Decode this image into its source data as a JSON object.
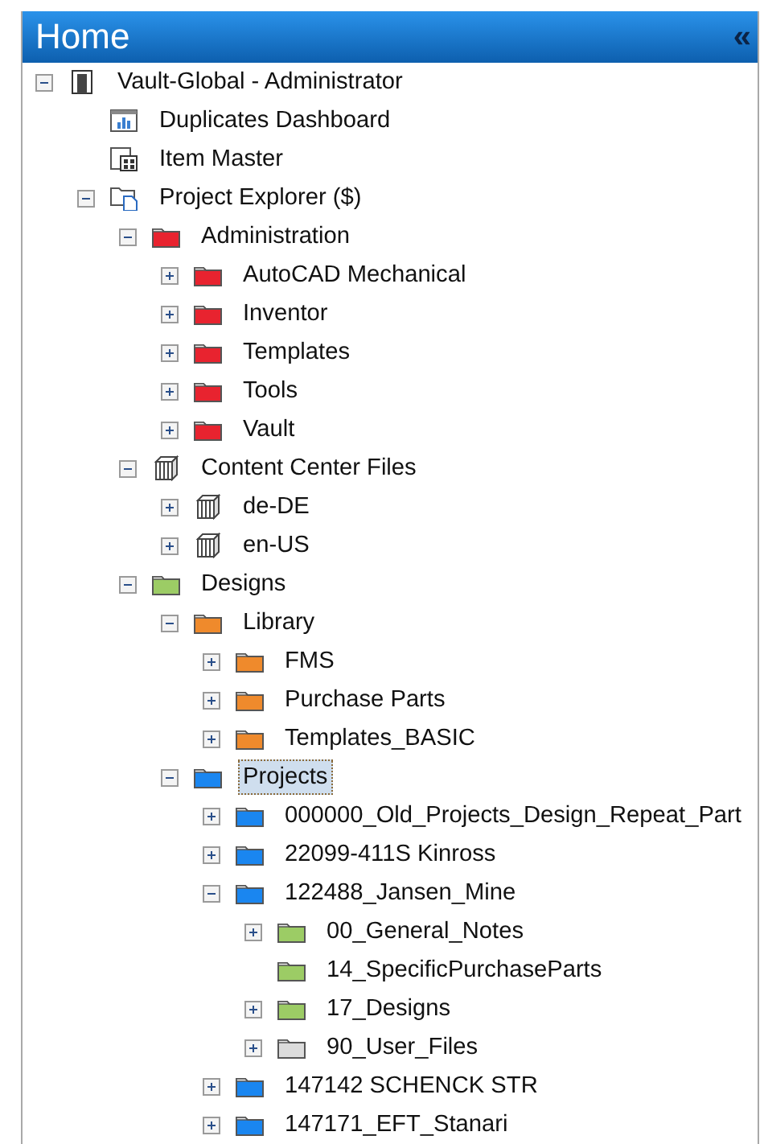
{
  "header": {
    "title": "Home",
    "collapse_glyph": "«"
  },
  "tree": [
    {
      "label": "Vault-Global - Administrator",
      "kind": "vault",
      "expandable": true,
      "expanded": true,
      "selected": false,
      "children": [
        {
          "label": "Duplicates Dashboard",
          "kind": "dashboard",
          "expandable": false,
          "selected": false
        },
        {
          "label": "Item Master",
          "kind": "itemmaster",
          "expandable": false,
          "selected": false
        },
        {
          "label": "Project Explorer ($)",
          "kind": "explorer",
          "expandable": true,
          "expanded": true,
          "selected": false,
          "children": [
            {
              "label": "Administration",
              "kind": "folder",
              "color": "#e8232f",
              "expandable": true,
              "expanded": true,
              "selected": false,
              "children": [
                {
                  "label": "AutoCAD Mechanical",
                  "kind": "folder",
                  "color": "#e8232f",
                  "expandable": true,
                  "expanded": false,
                  "selected": false
                },
                {
                  "label": "Inventor",
                  "kind": "folder",
                  "color": "#e8232f",
                  "expandable": true,
                  "expanded": false,
                  "selected": false
                },
                {
                  "label": "Templates",
                  "kind": "folder",
                  "color": "#e8232f",
                  "expandable": true,
                  "expanded": false,
                  "selected": false
                },
                {
                  "label": "Tools",
                  "kind": "folder",
                  "color": "#e8232f",
                  "expandable": true,
                  "expanded": false,
                  "selected": false
                },
                {
                  "label": "Vault",
                  "kind": "folder",
                  "color": "#e8232f",
                  "expandable": true,
                  "expanded": false,
                  "selected": false
                }
              ]
            },
            {
              "label": "Content Center Files",
              "kind": "library",
              "expandable": true,
              "expanded": true,
              "selected": false,
              "children": [
                {
                  "label": "de-DE",
                  "kind": "library",
                  "expandable": true,
                  "expanded": false,
                  "selected": false
                },
                {
                  "label": "en-US",
                  "kind": "library",
                  "expandable": true,
                  "expanded": false,
                  "selected": false
                }
              ]
            },
            {
              "label": "Designs",
              "kind": "folder",
              "color": "#9ccc65",
              "expandable": true,
              "expanded": true,
              "selected": false,
              "children": [
                {
                  "label": "Library",
                  "kind": "folder",
                  "color": "#ef8a2c",
                  "expandable": true,
                  "expanded": true,
                  "selected": false,
                  "children": [
                    {
                      "label": "FMS",
                      "kind": "folder",
                      "color": "#ef8a2c",
                      "expandable": true,
                      "expanded": false,
                      "selected": false
                    },
                    {
                      "label": "Purchase Parts",
                      "kind": "folder",
                      "color": "#ef8a2c",
                      "expandable": true,
                      "expanded": false,
                      "selected": false
                    },
                    {
                      "label": "Templates_BASIC",
                      "kind": "folder",
                      "color": "#ef8a2c",
                      "expandable": true,
                      "expanded": false,
                      "selected": false
                    }
                  ]
                },
                {
                  "label": "Projects",
                  "kind": "folder",
                  "color": "#1a86f0",
                  "expandable": true,
                  "expanded": true,
                  "selected": true,
                  "children": [
                    {
                      "label": "000000_Old_Projects_Design_Repeat_Part",
                      "kind": "folder",
                      "color": "#1a86f0",
                      "expandable": true,
                      "expanded": false,
                      "selected": false
                    },
                    {
                      "label": "22099-411S Kinross",
                      "kind": "folder",
                      "color": "#1a86f0",
                      "expandable": true,
                      "expanded": false,
                      "selected": false
                    },
                    {
                      "label": "122488_Jansen_Mine",
                      "kind": "folder",
                      "color": "#1a86f0",
                      "expandable": true,
                      "expanded": true,
                      "selected": false,
                      "children": [
                        {
                          "label": "00_General_Notes",
                          "kind": "folder",
                          "color": "#9ccc65",
                          "expandable": true,
                          "expanded": false,
                          "selected": false
                        },
                        {
                          "label": "14_SpecificPurchaseParts",
                          "kind": "folder",
                          "color": "#9ccc65",
                          "expandable": false,
                          "selected": false
                        },
                        {
                          "label": "17_Designs",
                          "kind": "folder",
                          "color": "#9ccc65",
                          "expandable": true,
                          "expanded": false,
                          "selected": false
                        },
                        {
                          "label": "90_User_Files",
                          "kind": "folder",
                          "color": "#dcdcdc",
                          "expandable": true,
                          "expanded": false,
                          "selected": false
                        }
                      ]
                    },
                    {
                      "label": "147142 SCHENCK STR",
                      "kind": "folder",
                      "color": "#1a86f0",
                      "expandable": true,
                      "expanded": false,
                      "selected": false
                    },
                    {
                      "label": "147171_EFT_Stanari",
                      "kind": "folder",
                      "color": "#1a86f0",
                      "expandable": true,
                      "expanded": false,
                      "selected": false
                    }
                  ]
                }
              ]
            }
          ]
        }
      ]
    }
  ]
}
